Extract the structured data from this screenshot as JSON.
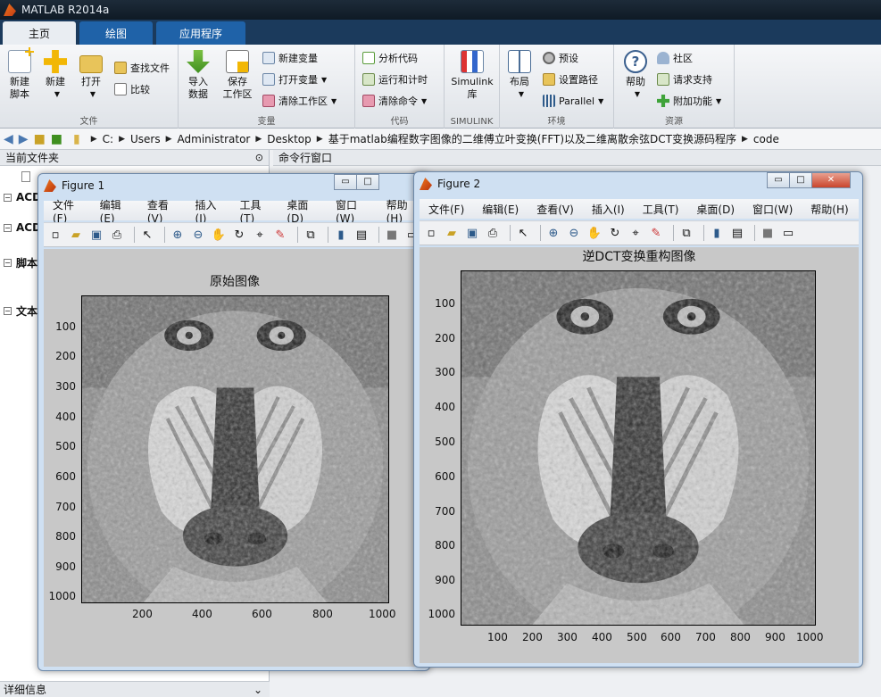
{
  "window": {
    "title": "MATLAB R2014a"
  },
  "ribbon_tabs": [
    "主页",
    "绘图",
    "应用程序"
  ],
  "ribbon": {
    "file": {
      "label": "文件",
      "new_script": [
        "新建",
        "脚本"
      ],
      "new": "新建",
      "open": "打开",
      "find_files": "查找文件",
      "compare": "比较"
    },
    "variable": {
      "label": "变量",
      "import": [
        "导入",
        "数据"
      ],
      "save_ws": [
        "保存",
        "工作区"
      ],
      "new_var": "新建变量",
      "open_var": "打开变量",
      "clear_ws": "清除工作区"
    },
    "code": {
      "label": "代码",
      "analyze": "分析代码",
      "run_time": "运行和计时",
      "clear_cmd": "清除命令"
    },
    "simulink": {
      "label": "SIMULINK",
      "btn": [
        "Simulink",
        "库"
      ]
    },
    "env": {
      "label": "环境",
      "layout": "布局",
      "prefs": "预设",
      "set_path": "设置路径",
      "parallel": "Parallel"
    },
    "res": {
      "label": "资源",
      "help": "帮助",
      "community": "社区",
      "support": "请求支持",
      "addons": "附加功能"
    }
  },
  "address": [
    "C:",
    "Users",
    "Administrator",
    "Desktop",
    "基于matlab编程数字图像的二维傅立叶变换(FFT)以及二维离散余弦DCT变换源码程序",
    "code"
  ],
  "left_panel": {
    "header": "当前文件夹",
    "items": [
      "ACD",
      "ACD",
      "脚本",
      "文本"
    ]
  },
  "command_window": {
    "header": "命令行窗口"
  },
  "details": {
    "label": "详细信息"
  },
  "menu": [
    "文件(F)",
    "编辑(E)",
    "查看(V)",
    "插入(I)",
    "工具(T)",
    "桌面(D)",
    "窗口(W)",
    "帮助(H)"
  ],
  "figure1": {
    "title": "Figure 1",
    "plot_title": "原始图像",
    "yticks": [
      "100",
      "200",
      "300",
      "400",
      "500",
      "600",
      "700",
      "800",
      "900",
      "1000"
    ],
    "xticks": [
      "200",
      "400",
      "600",
      "800",
      "1000"
    ]
  },
  "figure2": {
    "title": "Figure 2",
    "plot_title": "逆DCT变换重构图像",
    "yticks": [
      "100",
      "200",
      "300",
      "400",
      "500",
      "600",
      "700",
      "800",
      "900",
      "1000"
    ],
    "xticks": [
      "100",
      "200",
      "300",
      "400",
      "500",
      "600",
      "700",
      "800",
      "900",
      "1000"
    ]
  },
  "colors": {
    "title_bar": "#1d2b39",
    "ribbon_tab_active": "#e9edf2",
    "ribbon_tab": "#1f62a8",
    "figure_frame": "#cfe0f2",
    "plot_bg": "#c8c8c8"
  }
}
